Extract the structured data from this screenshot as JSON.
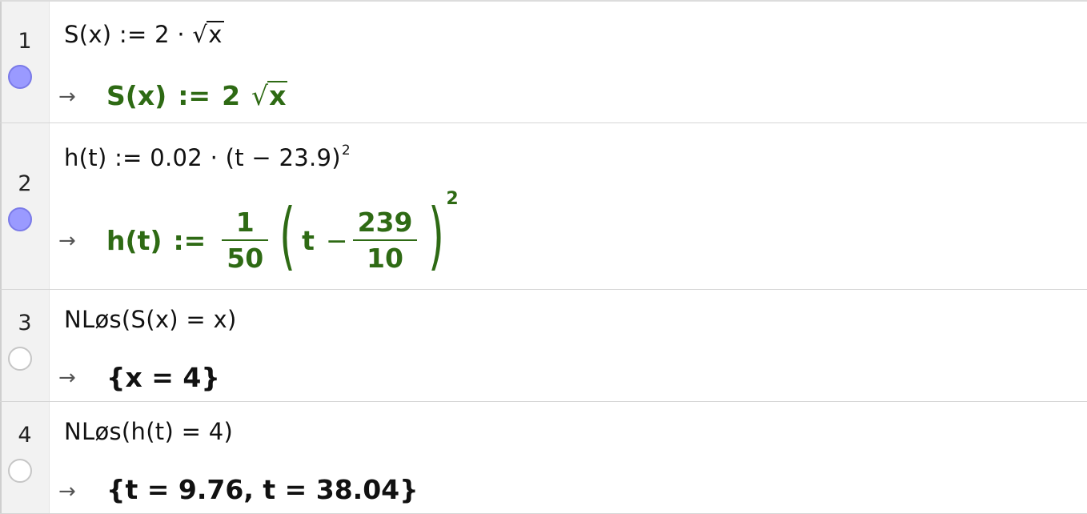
{
  "cells": [
    {
      "number": "1",
      "marble": "on",
      "input": "S(x) :=  2 · ",
      "input_sqrt_arg": "x",
      "arrow": "→",
      "output_lhs": "S(x)",
      "output_assign": ":=",
      "output_coef": "2",
      "output_sqrt_arg": "x"
    },
    {
      "number": "2",
      "marble": "on",
      "input": "h(t) :=  0.02 · (t − 23.9)",
      "input_exp": "2",
      "arrow": "→",
      "output_lhs": "h(t)",
      "output_assign": ":=",
      "frac1_num": "1",
      "frac1_den": "50",
      "paren_open": "(",
      "var": "t",
      "minus": "−",
      "frac2_num": "239",
      "frac2_den": "10",
      "paren_close": ")",
      "output_exp": "2"
    },
    {
      "number": "3",
      "marble": "off",
      "input": "NLøs(S(x)  =  x)",
      "arrow": "→",
      "output": "{x = 4}"
    },
    {
      "number": "4",
      "marble": "off",
      "input": "NLøs(h(t)  =  4)",
      "arrow": "→",
      "output": "{t = 9.76, t = 38.04}"
    }
  ],
  "colors": {
    "output_green": "#2e6a14",
    "marble_on": "#9a9aff",
    "gutter": "#f2f2f2"
  }
}
